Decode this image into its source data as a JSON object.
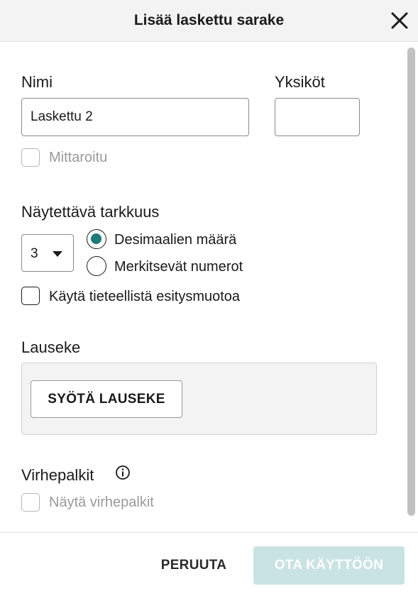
{
  "dialog": {
    "title": "Lisää laskettu sarake"
  },
  "name_field": {
    "label": "Nimi",
    "value": "Laskettu 2"
  },
  "units_field": {
    "label": "Yksiköt",
    "value": ""
  },
  "measured_checkbox": {
    "label": "Mittaroitu",
    "checked": false,
    "disabled": true
  },
  "precision": {
    "label": "Näytettävä tarkkuus",
    "selected_value": "3",
    "options": [
      {
        "label": "Desimaalien määrä",
        "selected": true
      },
      {
        "label": "Merkitsevät numerot",
        "selected": false
      }
    ],
    "scientific": {
      "label": "Käytä tieteellistä esitysmuotoa",
      "checked": false
    }
  },
  "expression": {
    "label": "Lauseke",
    "button_label": "SYÖTÄ LAUSEKE"
  },
  "error_bars": {
    "label": "Virhepalkit",
    "checkbox_label": "Näytä virhepalkit",
    "checked": false,
    "disabled": true
  },
  "footer": {
    "cancel_label": "PERUUTA",
    "apply_label": "OTA KÄYTTÖÖN",
    "apply_disabled": true
  },
  "colors": {
    "accent": "#1f7a7a",
    "apply_disabled_bg": "#c9e3e2",
    "header_bg": "#f3f3f3"
  },
  "icons": {
    "close": "close-icon",
    "dropdown": "caret-down-icon",
    "info": "info-icon"
  }
}
